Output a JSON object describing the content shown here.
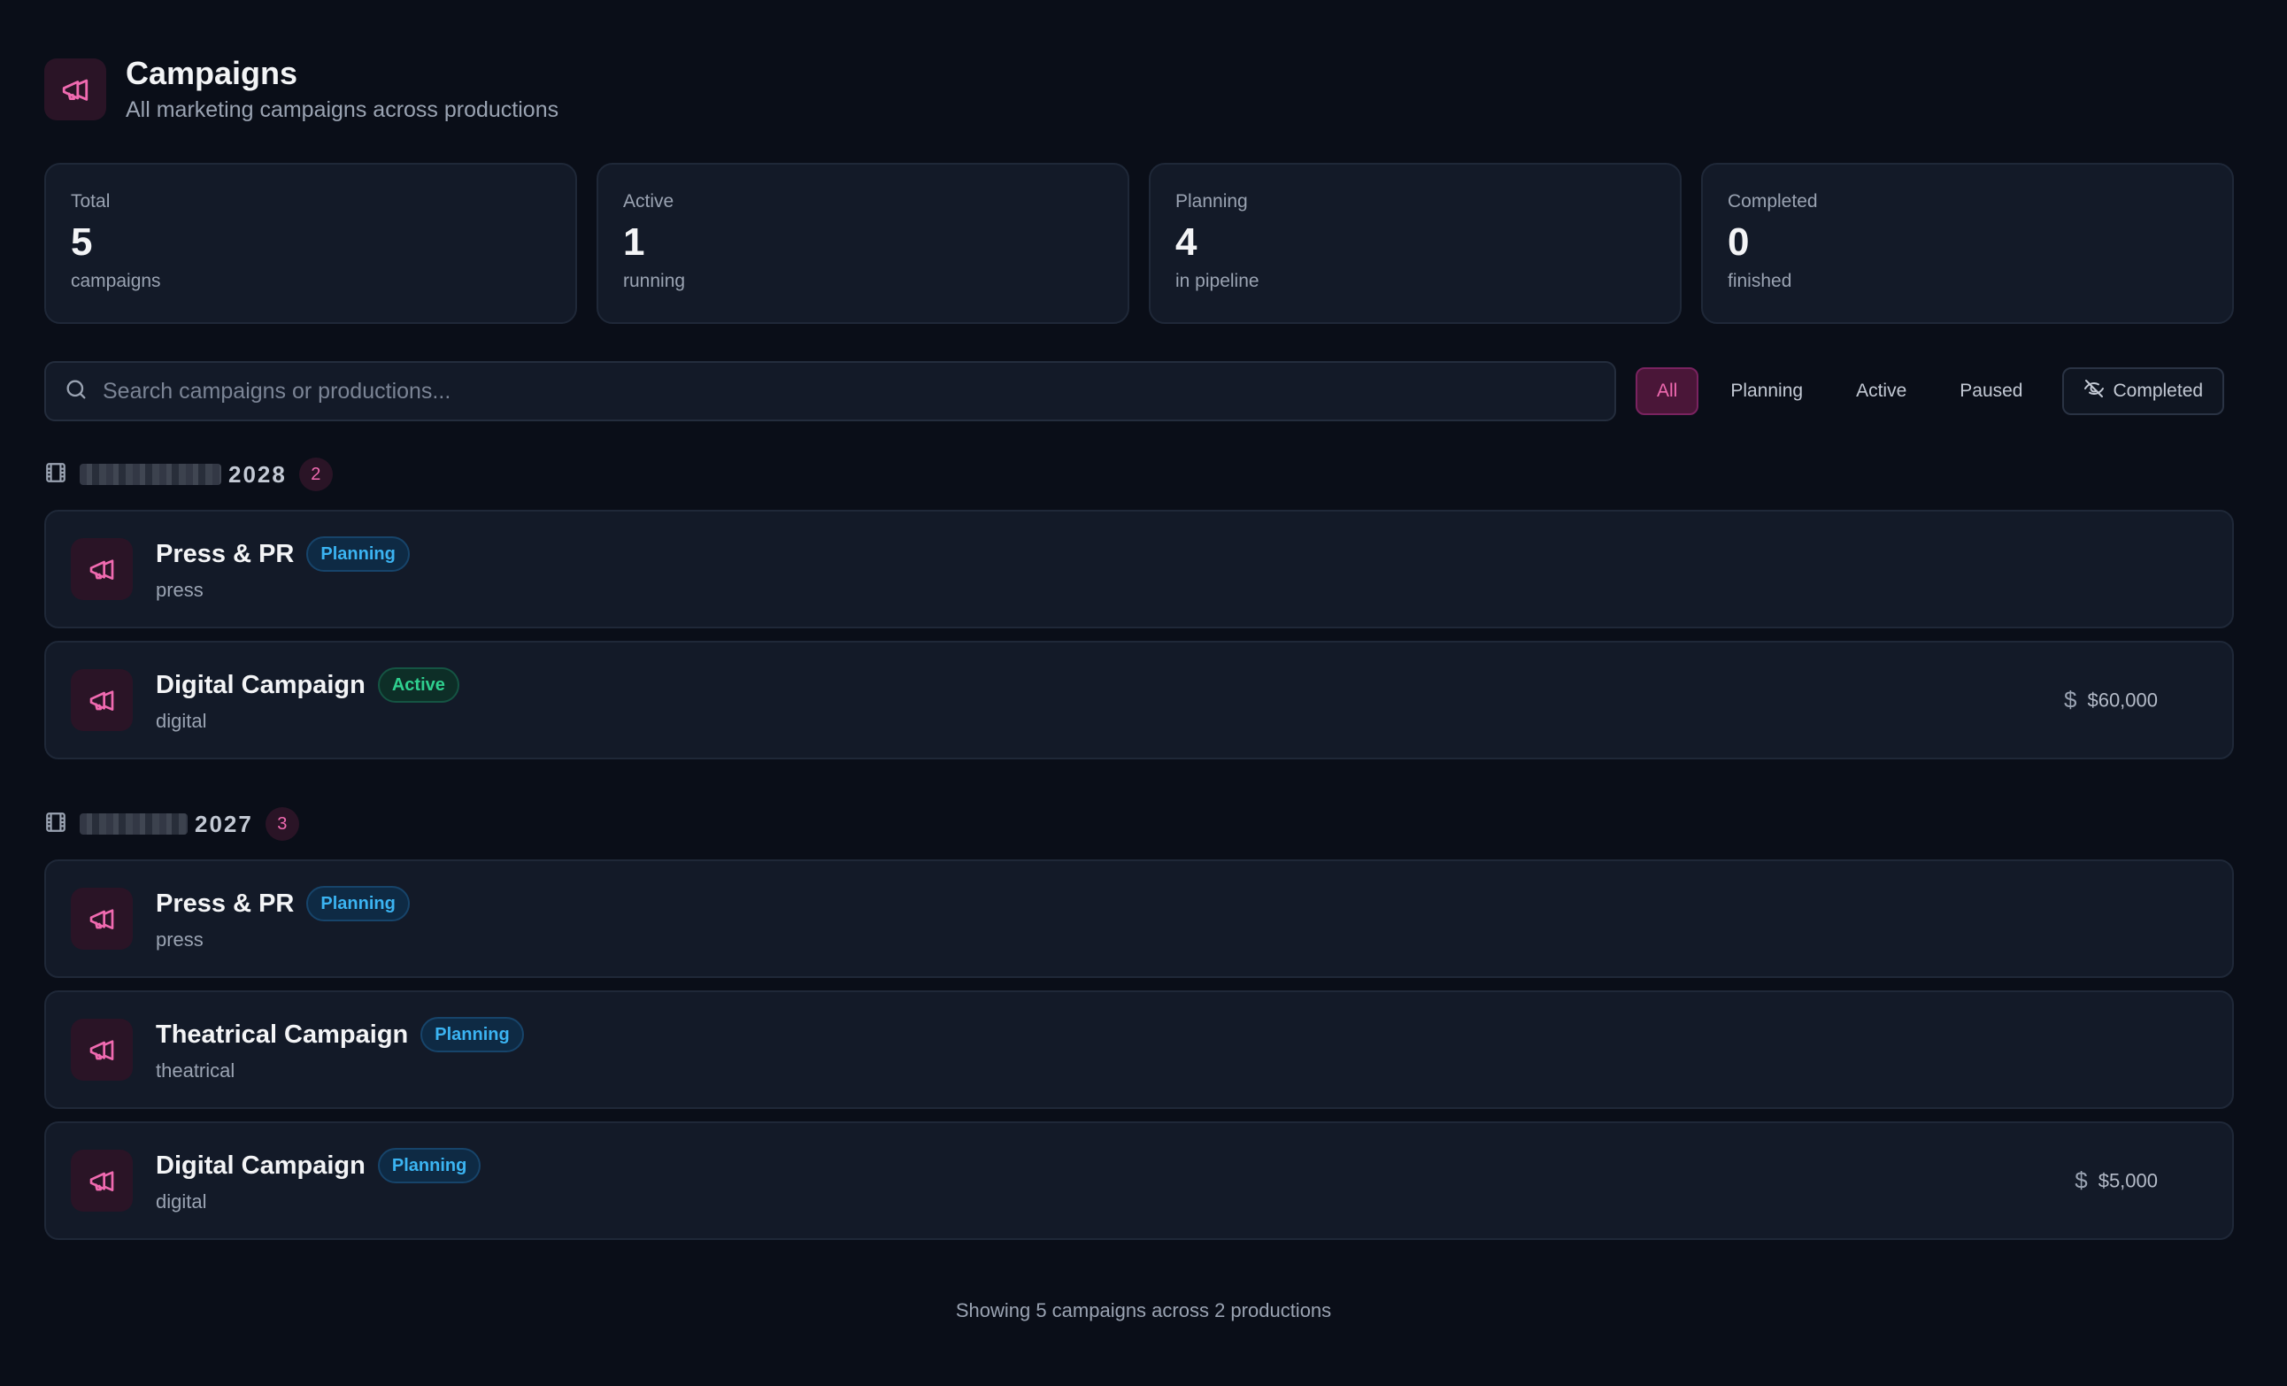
{
  "header": {
    "title": "Campaigns",
    "subtitle": "All marketing campaigns across productions",
    "icon": "megaphone-icon"
  },
  "stats": [
    {
      "label": "Total",
      "value": "5",
      "sub": "campaigns"
    },
    {
      "label": "Active",
      "value": "1",
      "sub": "running"
    },
    {
      "label": "Planning",
      "value": "4",
      "sub": "in pipeline"
    },
    {
      "label": "Completed",
      "value": "0",
      "sub": "finished"
    }
  ],
  "search": {
    "placeholder": "Search campaigns or productions...",
    "value": ""
  },
  "filters": {
    "all": "All",
    "planning": "Planning",
    "active": "Active",
    "paused": "Paused",
    "completed": "Completed",
    "selected": "All"
  },
  "groups": [
    {
      "year": "2028",
      "count": "2",
      "campaigns": [
        {
          "name": "Press & PR",
          "status": "Planning",
          "type": "press",
          "budget": ""
        },
        {
          "name": "Digital Campaign",
          "status": "Active",
          "type": "digital",
          "budget": "$60,000"
        }
      ]
    },
    {
      "year": "2027",
      "count": "3",
      "campaigns": [
        {
          "name": "Press & PR",
          "status": "Planning",
          "type": "press",
          "budget": ""
        },
        {
          "name": "Theatrical Campaign",
          "status": "Planning",
          "type": "theatrical",
          "budget": ""
        },
        {
          "name": "Digital Campaign",
          "status": "Planning",
          "type": "digital",
          "budget": "$5,000"
        }
      ]
    }
  ],
  "footer": "Showing 5 campaigns across 2 productions",
  "colors": {
    "background": "#0a0e18",
    "card": "#131a28",
    "accent": "#f06ab0",
    "planning": "#3bb4f2",
    "active": "#2fd08f"
  }
}
